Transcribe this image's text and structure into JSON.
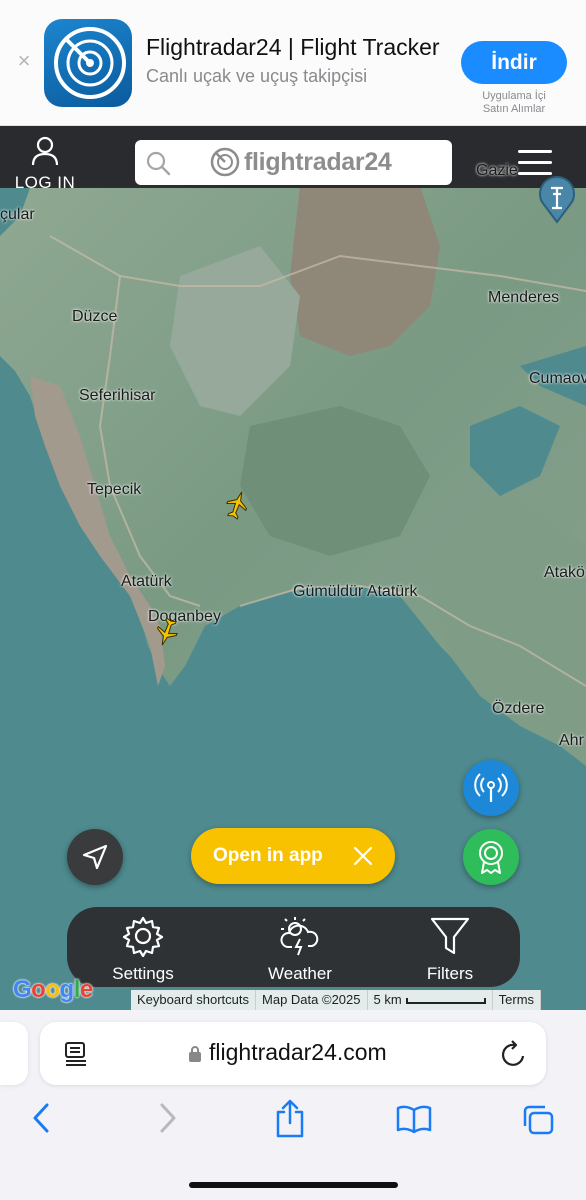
{
  "banner": {
    "app_name": "Flightradar24 | Flight Tracker",
    "subtitle": "Canlı uçak ve uçuş takipçisi",
    "get_label": "İndir",
    "iap_line1": "Uygulama İçi",
    "iap_line2": "Satın Alımlar"
  },
  "header": {
    "login_label": "LOG IN",
    "logo_text": "flightradar24"
  },
  "map": {
    "places": {
      "gazie": "Gazie",
      "cular": "çular",
      "menderes": "Menderes",
      "duzce": "Düzce",
      "cumaov": "Cumaov",
      "seferihisar": "Seferihisar",
      "tepecik": "Tepecik",
      "ataturk1": "Atatürk",
      "atako": "Atakö",
      "gumuldur": "Gümüldür Atatürk",
      "doganbey": "Doganbey",
      "ozdere": "Özdere",
      "ahr": "Ahr"
    },
    "open_in_app_label": "Open in app",
    "tools": {
      "settings": "Settings",
      "weather": "Weather",
      "filters": "Filters"
    },
    "google_logo": "Google",
    "attribution": {
      "keyboard": "Keyboard shortcuts",
      "map_data": "Map Data ©2025",
      "scale": "5 km",
      "terms": "Terms"
    }
  },
  "browser": {
    "url": "flightradar24.com"
  },
  "colors": {
    "get_button": "#1a8cff",
    "open_in_app": "#f8c200",
    "feed_fab": "#1e88d8",
    "badge_fab": "#2fbc5b",
    "sea": "#4e8a8e",
    "ios_blue": "#1a7cf5"
  }
}
